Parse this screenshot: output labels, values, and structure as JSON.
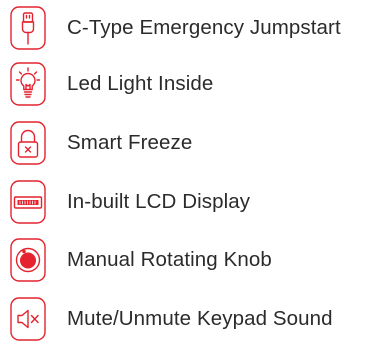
{
  "accent_color": "#e4232e",
  "text_color": "#2b2b2b",
  "features": [
    {
      "icon": "usb-c-cable-icon",
      "label": "C-Type Emergency Jumpstart"
    },
    {
      "icon": "led-bulb-icon",
      "label": "Led Light Inside"
    },
    {
      "icon": "padlock-icon",
      "label": "Smart Freeze"
    },
    {
      "icon": "lcd-display-icon",
      "label": "In-built LCD Display"
    },
    {
      "icon": "rotating-knob-icon",
      "label": "Manual Rotating Knob"
    },
    {
      "icon": "speaker-mute-icon",
      "label": "Mute/Unmute Keypad Sound"
    }
  ]
}
